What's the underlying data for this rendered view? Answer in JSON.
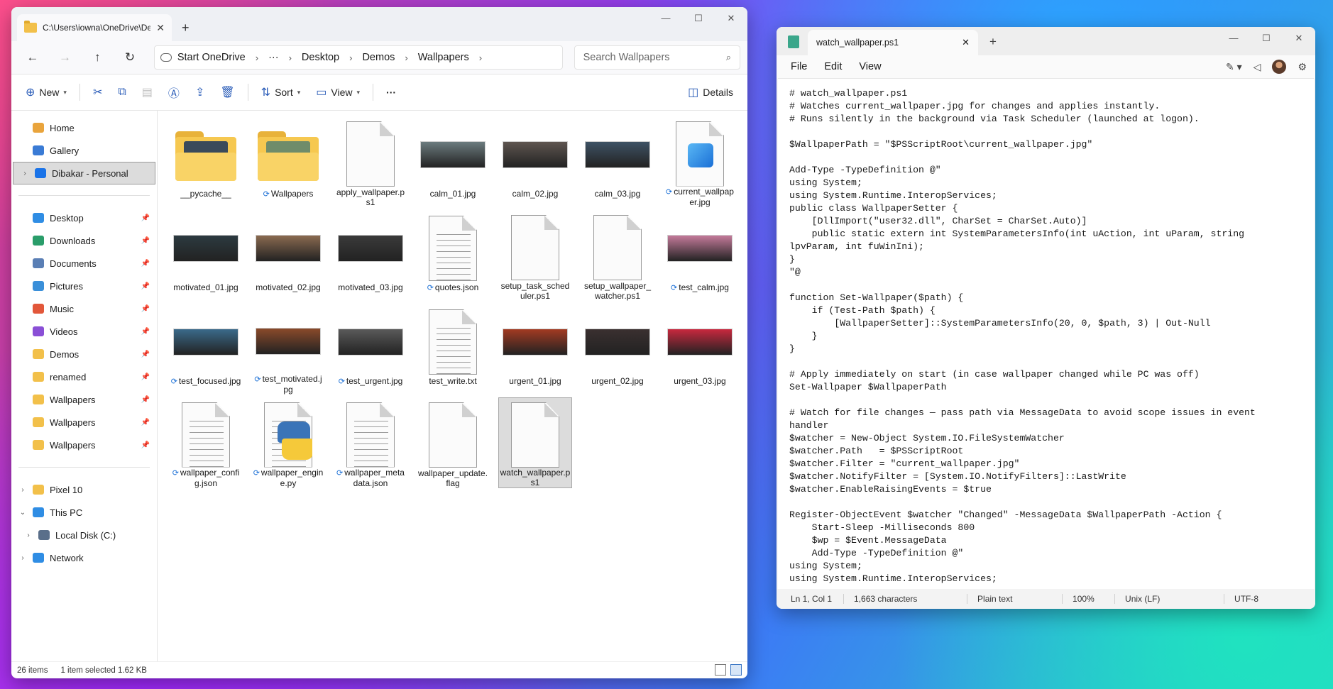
{
  "explorer": {
    "tab_title": "C:\\Users\\iowna\\OneDrive\\De",
    "window_controls": [
      "—",
      "☐",
      "✕"
    ],
    "nav": {
      "back": "←",
      "forward": "→",
      "up": "↑",
      "refresh": "↻"
    },
    "address": {
      "onedrive_label": "Start OneDrive",
      "more": "···",
      "crumbs": [
        "Desktop",
        "Demos",
        "Wallpapers"
      ]
    },
    "search_placeholder": "Search Wallpapers",
    "toolbar": {
      "new_label": "New",
      "sort_label": "Sort",
      "view_label": "View",
      "more_label": "···",
      "details_label": "Details"
    },
    "sidebar": {
      "top": [
        {
          "label": "Home",
          "icon": "home-icon",
          "color": "#e9a43c"
        },
        {
          "label": "Gallery",
          "icon": "gallery-icon",
          "color": "#3a7bd5"
        },
        {
          "label": "Dibakar - Personal",
          "icon": "onedrive-icon",
          "color": "#1a73e8"
        }
      ],
      "quick": [
        {
          "label": "Desktop",
          "icon": "desktop-icon",
          "color": "#2f8de4"
        },
        {
          "label": "Downloads",
          "icon": "download-icon",
          "color": "#2a9d6a"
        },
        {
          "label": "Documents",
          "icon": "documents-icon",
          "color": "#5a7fb5"
        },
        {
          "label": "Pictures",
          "icon": "pictures-icon",
          "color": "#3a8fd9"
        },
        {
          "label": "Music",
          "icon": "music-icon",
          "color": "#e2573a"
        },
        {
          "label": "Videos",
          "icon": "videos-icon",
          "color": "#8a4fd6"
        },
        {
          "label": "Demos",
          "icon": "folder-icon",
          "color": "#f2c04a"
        },
        {
          "label": "renamed",
          "icon": "folder-icon",
          "color": "#f2c04a"
        },
        {
          "label": "Wallpapers",
          "icon": "folder-icon",
          "color": "#f2c04a"
        },
        {
          "label": "Wallpapers",
          "icon": "folder-icon",
          "color": "#f2c04a"
        },
        {
          "label": "Wallpapers",
          "icon": "folder-icon",
          "color": "#f2c04a"
        }
      ],
      "devices": [
        {
          "label": "Pixel 10",
          "icon": "folder-icon",
          "color": "#f2c04a"
        },
        {
          "label": "This PC",
          "icon": "pc-icon",
          "color": "#2f8de4"
        },
        {
          "label": "Local Disk (C:)",
          "icon": "disk-icon",
          "color": "#5a6f8a"
        },
        {
          "label": "Network",
          "icon": "network-icon",
          "color": "#2f8de4"
        }
      ]
    },
    "files": [
      {
        "name": "__pycache__",
        "kind": "folder",
        "sync": false,
        "inner": "#3a4a5a"
      },
      {
        "name": "Wallpapers",
        "kind": "folder",
        "sync": true,
        "inner": "#6f8c6a"
      },
      {
        "name": "apply_wallpaper.ps1",
        "kind": "doc",
        "sync": false
      },
      {
        "name": "calm_01.jpg",
        "kind": "photo",
        "sync": false,
        "color": "#6b7b7e"
      },
      {
        "name": "calm_02.jpg",
        "kind": "photo",
        "sync": false,
        "color": "#5e5550"
      },
      {
        "name": "calm_03.jpg",
        "kind": "photo",
        "sync": false,
        "color": "#3e5264"
      },
      {
        "name": "current_wallpaper.jpg",
        "kind": "image",
        "sync": true
      },
      {
        "name": "motivated_01.jpg",
        "kind": "photo",
        "sync": false,
        "color": "#2c3a40"
      },
      {
        "name": "motivated_02.jpg",
        "kind": "photo",
        "sync": false,
        "color": "#8a6a50"
      },
      {
        "name": "motivated_03.jpg",
        "kind": "photo",
        "sync": false,
        "color": "#3a3a3a"
      },
      {
        "name": "quotes.json",
        "kind": "textdoc",
        "sync": true
      },
      {
        "name": "setup_task_scheduler.ps1",
        "kind": "doc",
        "sync": false
      },
      {
        "name": "setup_wallpaper_watcher.ps1",
        "kind": "doc",
        "sync": false
      },
      {
        "name": "test_calm.jpg",
        "kind": "photo",
        "sync": true,
        "color": "#c47a9a"
      },
      {
        "name": "test_focused.jpg",
        "kind": "photo",
        "sync": true,
        "color": "#3a6a8a"
      },
      {
        "name": "test_motivated.jpg",
        "kind": "photo",
        "sync": true,
        "color": "#8a4a2a"
      },
      {
        "name": "test_urgent.jpg",
        "kind": "photo",
        "sync": true,
        "color": "#5a5a5a"
      },
      {
        "name": "test_write.txt",
        "kind": "textdoc",
        "sync": false
      },
      {
        "name": "urgent_01.jpg",
        "kind": "photo",
        "sync": false,
        "color": "#a23a22"
      },
      {
        "name": "urgent_02.jpg",
        "kind": "photo",
        "sync": false,
        "color": "#3a3030"
      },
      {
        "name": "urgent_03.jpg",
        "kind": "photo",
        "sync": false,
        "color": "#c8283e"
      },
      {
        "name": "wallpaper_config.json",
        "kind": "textdoc",
        "sync": true
      },
      {
        "name": "wallpaper_engine.py",
        "kind": "python",
        "sync": true
      },
      {
        "name": "wallpaper_metadata.json",
        "kind": "textdoc",
        "sync": true
      },
      {
        "name": "wallpaper_update.flag",
        "kind": "doc",
        "sync": false
      },
      {
        "name": "watch_wallpaper.ps1",
        "kind": "doc",
        "sync": false,
        "selected": true
      }
    ],
    "status": {
      "count": "26 items",
      "selection": "1 item selected  1.62 KB"
    }
  },
  "notepad": {
    "tab_title": "watch_wallpaper.ps1",
    "menu": [
      "File",
      "Edit",
      "View"
    ],
    "content": "# watch_wallpaper.ps1\n# Watches current_wallpaper.jpg for changes and applies instantly.\n# Runs silently in the background via Task Scheduler (launched at logon).\n\n$WallpaperPath = \"$PSScriptRoot\\current_wallpaper.jpg\"\n\nAdd-Type -TypeDefinition @\"\nusing System;\nusing System.Runtime.InteropServices;\npublic class WallpaperSetter {\n    [DllImport(\"user32.dll\", CharSet = CharSet.Auto)]\n    public static extern int SystemParametersInfo(int uAction, int uParam, string\nlpvParam, int fuWinIni);\n}\n\"@\n\nfunction Set-Wallpaper($path) {\n    if (Test-Path $path) {\n        [WallpaperSetter]::SystemParametersInfo(20, 0, $path, 3) | Out-Null\n    }\n}\n\n# Apply immediately on start (in case wallpaper changed while PC was off)\nSet-Wallpaper $WallpaperPath\n\n# Watch for file changes — pass path via MessageData to avoid scope issues in event\nhandler\n$watcher = New-Object System.IO.FileSystemWatcher\n$watcher.Path   = $PSScriptRoot\n$watcher.Filter = \"current_wallpaper.jpg\"\n$watcher.NotifyFilter = [System.IO.NotifyFilters]::LastWrite\n$watcher.EnableRaisingEvents = $true\n\nRegister-ObjectEvent $watcher \"Changed\" -MessageData $WallpaperPath -Action {\n    Start-Sleep -Milliseconds 800\n    $wp = $Event.MessageData\n    Add-Type -TypeDefinition @\"\nusing System;\nusing System.Runtime.InteropServices;",
    "status": {
      "position": "Ln 1, Col 1",
      "chars": "1,663 characters",
      "type": "Plain text",
      "zoom": "100%",
      "eol": "Unix (LF)",
      "encoding": "UTF-8"
    }
  }
}
